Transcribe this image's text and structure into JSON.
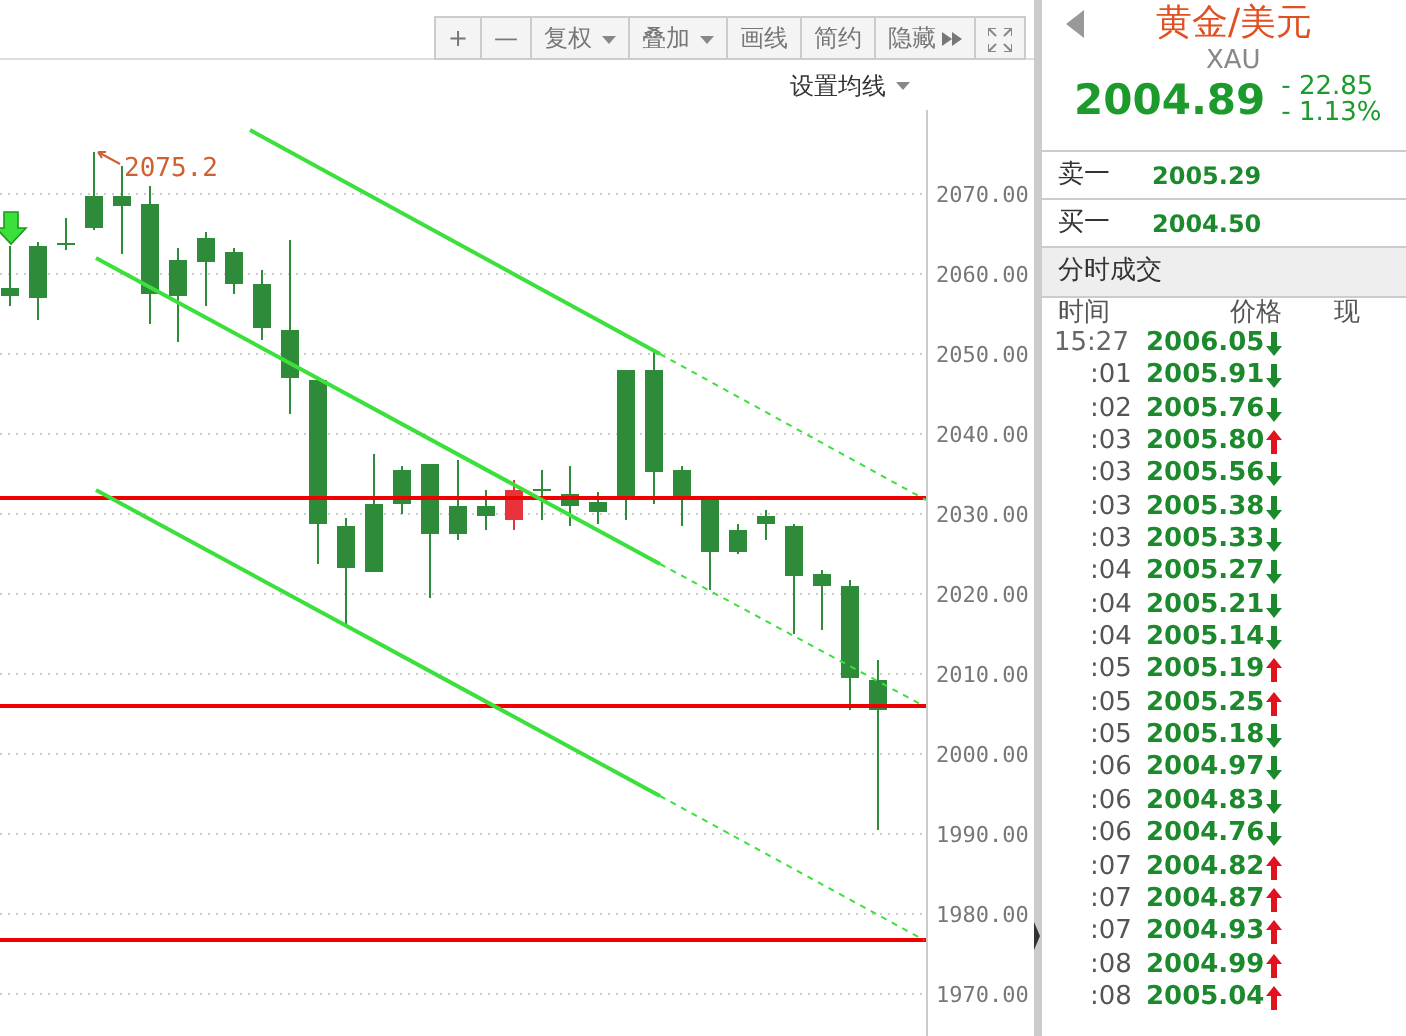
{
  "toolbar": {
    "buttons": [
      {
        "label": "+",
        "kind": "plain"
      },
      {
        "label": "—",
        "kind": "plain"
      },
      {
        "label": "复权",
        "kind": "dropdown"
      },
      {
        "label": "叠加",
        "kind": "dropdown"
      },
      {
        "label": "画线",
        "kind": "plain"
      },
      {
        "label": "简约",
        "kind": "plain"
      },
      {
        "label": "隐藏",
        "kind": "hide"
      },
      {
        "kind": "fullscreen"
      }
    ]
  },
  "ma_setting": {
    "label": "设置均线"
  },
  "chart": {
    "high_label": "2075.2",
    "chart_data": {
      "type": "candlestick",
      "ohlc": [
        [
          2058.25,
          2063.5,
          2056,
          2057.25
        ],
        [
          2063.5,
          2064,
          2054.25,
          2057
        ],
        [
          2063.75,
          2067,
          2063,
          2063.75
        ],
        [
          2069.75,
          2075.25,
          2065.5,
          2065.75
        ],
        [
          2069.75,
          2073.5,
          2062.5,
          2068.5
        ],
        [
          2068.75,
          2071,
          2053.75,
          2057.5
        ],
        [
          2061.75,
          2063.25,
          2051.5,
          2057.25
        ],
        [
          2064.5,
          2065.25,
          2056,
          2061.5
        ],
        [
          2062.75,
          2063.25,
          2057.5,
          2058.75
        ],
        [
          2058.75,
          2060.5,
          2051.75,
          2053.25
        ],
        [
          2053,
          2064.25,
          2042.5,
          2047
        ],
        [
          2046.75,
          2046.75,
          2023.75,
          2028.75
        ],
        [
          2028.5,
          2029.5,
          2016,
          2023.25
        ],
        [
          2031.25,
          2037.5,
          2022.75,
          2022.75
        ],
        [
          2035.5,
          2036,
          2030,
          2031.25
        ],
        [
          2036.25,
          2036.25,
          2019.5,
          2027.5
        ],
        [
          2031,
          2036.75,
          2026.75,
          2027.5
        ],
        [
          2031,
          2033,
          2028,
          2029.75
        ],
        [
          2029.25,
          2034.25,
          2028,
          2033
        ],
        [
          2033,
          2035.5,
          2029.25,
          2033
        ],
        [
          2032.5,
          2036,
          2028.5,
          2031
        ],
        [
          2031.5,
          2032.75,
          2028.75,
          2030.25
        ],
        [
          2048,
          2048,
          2029.25,
          2032.25
        ],
        [
          2048,
          2050.5,
          2031.25,
          2035.25
        ],
        [
          2035.5,
          2036,
          2028.5,
          2032.25
        ],
        [
          2032,
          2032,
          2020.5,
          2025.25
        ],
        [
          2028,
          2028.75,
          2025,
          2025.25
        ],
        [
          2029.75,
          2030.5,
          2026.75,
          2028.75
        ],
        [
          2028.5,
          2028.75,
          2015,
          2022.25
        ],
        [
          2022.5,
          2023,
          2015.5,
          2021
        ],
        [
          2021,
          2021.75,
          2005.5,
          2009.5
        ],
        [
          2009.25,
          2011.75,
          1990.5,
          2005.5
        ]
      ],
      "ylim": [
        1964.75,
        2080.5
      ],
      "grid": true,
      "yticks": [
        {
          "value": 2070,
          "label": "2070.00"
        },
        {
          "value": 2060,
          "label": "2060.00"
        },
        {
          "value": 2050,
          "label": "2050.00"
        },
        {
          "value": 2040,
          "label": "2040.00"
        },
        {
          "value": 2030,
          "label": "2030.00"
        },
        {
          "value": 2020,
          "label": "2020.00"
        },
        {
          "value": 2010,
          "label": "2010.00"
        },
        {
          "value": 2000,
          "label": "2000.00"
        },
        {
          "value": 1990,
          "label": "1990.00"
        },
        {
          "value": 1980,
          "label": "1980.00"
        },
        {
          "value": 1970,
          "label": "1970.00"
        }
      ]
    }
  },
  "quote": {
    "name": "黄金/美元",
    "code": "XAU",
    "price": "2004.89",
    "change": "- 22.85",
    "change_pct": "- 1.13%"
  },
  "book": [
    {
      "label": "卖一",
      "price": "2005.29"
    },
    {
      "label": "买一",
      "price": "2004.50"
    }
  ],
  "trades": {
    "title": "分时成交",
    "columns": [
      "时间",
      "价格",
      "现"
    ],
    "rows": [
      {
        "time": "15:27",
        "price": "2006.05",
        "up": false
      },
      {
        "time": ":01",
        "price": "2005.91",
        "up": false
      },
      {
        "time": ":02",
        "price": "2005.76",
        "up": false
      },
      {
        "time": ":03",
        "price": "2005.80",
        "up": true
      },
      {
        "time": ":03",
        "price": "2005.56",
        "up": false
      },
      {
        "time": ":03",
        "price": "2005.38",
        "up": false
      },
      {
        "time": ":03",
        "price": "2005.33",
        "up": false
      },
      {
        "time": ":04",
        "price": "2005.27",
        "up": false
      },
      {
        "time": ":04",
        "price": "2005.21",
        "up": false
      },
      {
        "time": ":04",
        "price": "2005.14",
        "up": false
      },
      {
        "time": ":05",
        "price": "2005.19",
        "up": true
      },
      {
        "time": ":05",
        "price": "2005.25",
        "up": true
      },
      {
        "time": ":05",
        "price": "2005.18",
        "up": false
      },
      {
        "time": ":06",
        "price": "2004.97",
        "up": false
      },
      {
        "time": ":06",
        "price": "2004.83",
        "up": false
      },
      {
        "time": ":06",
        "price": "2004.76",
        "up": false
      },
      {
        "time": ":07",
        "price": "2004.82",
        "up": true
      },
      {
        "time": ":07",
        "price": "2004.87",
        "up": true
      },
      {
        "time": ":07",
        "price": "2004.93",
        "up": true
      },
      {
        "time": ":08",
        "price": "2004.99",
        "up": true
      },
      {
        "time": ":08",
        "price": "2005.04",
        "up": true
      }
    ]
  }
}
